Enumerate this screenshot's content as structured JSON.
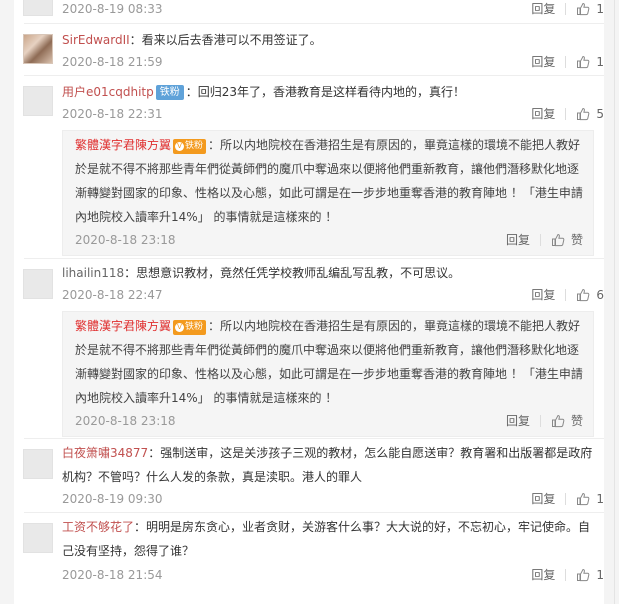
{
  "colors": {
    "username": "#c1504f",
    "badge_blue": "#5fa2d9",
    "badge_orange": "#f39a1e",
    "meta_gray": "#999999"
  },
  "reply_label": "回复",
  "like_label": "赞",
  "comments": [
    {
      "time": "2020-8-19 08:33",
      "likes": "1"
    },
    {
      "user": "SirEdwardII",
      "text": "：看来以后去香港可以不用签证了。",
      "time": "2020-8-18 21:59",
      "likes": "1"
    },
    {
      "user": "用户e01cqdhitp",
      "badge": "铁粉",
      "text": "：回归23年了，香港教育是这样看待内地的，真行！",
      "time": "2020-8-18 22:31",
      "likes": "5",
      "quote": {
        "user": "繁體漢字君陳方翼",
        "badge": "铁粉",
        "text": "：所以内地院校在香港招生是有原因的，畢竟這樣的環境不能把人教好於是就不得不將那些青年們從黃師們的魔爪中奪過來以便將他們重新教育，讓他們潛移默化地逐漸轉變對國家的印象、性格以及心態，如此可謂是在一步步地重奪香港的教育陣地 ！「港生申請內地院校入讀率升14%」 的事情就是這樣來的 ！",
        "time": "2020-8-18 23:18"
      }
    },
    {
      "user": "lihailin118",
      "text": "：思想意识教材，竟然任凭学校教师乱编乱写乱教，不可思议。",
      "time": "2020-8-18 22:47",
      "likes": "6",
      "quote": {
        "user": "繁體漢字君陳方翼",
        "badge": "铁粉",
        "text": "：所以内地院校在香港招生是有原因的，畢竟這樣的環境不能把人教好於是就不得不將那些青年們從黃師們的魔爪中奪過來以便將他們重新教育，讓他們潛移默化地逐漸轉變對國家的印象、性格以及心態，如此可謂是在一步步地重奪香港的教育陣地 ！「港生申請內地院校入讀率升14%」 的事情就是這樣來的 ！",
        "time": "2020-8-18 23:18"
      }
    },
    {
      "user": "白夜箫嘯34877",
      "text": "：强制送审，这是关涉孩子三观的教材，怎么能自愿送审？教育署和出版署都是政府机构？不管吗？什么人发的条款，真是渎职。港人的罪人",
      "time": "2020-8-19 09:30",
      "likes": "1"
    },
    {
      "user": "工资不够花了",
      "text": "：明明是房东贪心，业者贪财，关游客什么事？大大说的好，不忘初心，牢记使命。自己没有坚持，怨得了谁？",
      "time": "2020-8-18 21:54",
      "likes": "1"
    }
  ]
}
